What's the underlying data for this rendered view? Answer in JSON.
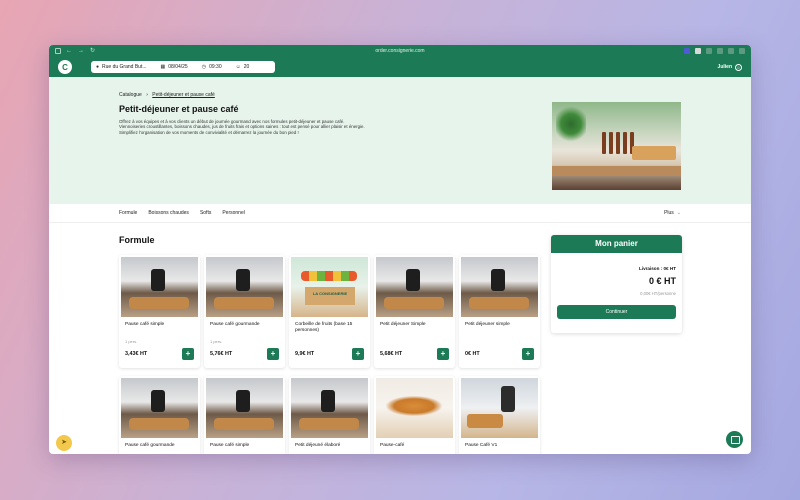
{
  "browser": {
    "url": "order.consignerie.com"
  },
  "header": {
    "address": "Rue du Grand But...",
    "date": "08/04/25",
    "time": "09:30",
    "guests": "20",
    "user": "Julien"
  },
  "hero": {
    "breadcrumb_root": "Catalogue",
    "breadcrumb_current": "Petit-déjeuner et pause café",
    "title": "Petit-déjeuner et pause café",
    "description_1": "Offrez à vos équipes et à vos clients un début de journée gourmand avec nos formules petit-déjeuner et pause café.",
    "description_2": "Viennoiseries croustillantes, boissons chaudes, jus de fruits frais et options saines : tout est pensé pour allier plaisir et énergie.",
    "description_3": "Simplifiez l'organisation de vos moments de convivialité et démarrez la journée du bon pied !"
  },
  "tabs": {
    "items": [
      "Formule",
      "Boissons chaudes",
      "Softs",
      "Personnel"
    ],
    "more": "Plus"
  },
  "section": {
    "title": "Formule"
  },
  "products": [
    {
      "name": "Pause café simple",
      "sub": "1 pers.",
      "price": "3,43€ HT"
    },
    {
      "name": "Pause café gourmande",
      "sub": "1 pers.",
      "price": "5,76€ HT"
    },
    {
      "name": "Corbeille de fruits (base 15 personnes)",
      "sub": "",
      "price": "9,9€ HT"
    },
    {
      "name": "Petit déjeuner Simple",
      "sub": "",
      "price": "5,68€ HT"
    },
    {
      "name": "Petit déjeuner simple",
      "sub": "",
      "price": "0€ HT"
    },
    {
      "name": "Pause café gourmande",
      "sub": "",
      "price": ""
    },
    {
      "name": "Pause café simple",
      "sub": "",
      "price": ""
    },
    {
      "name": "Petit déjeuné élaboré",
      "sub": "",
      "price": ""
    },
    {
      "name": "Pause-café",
      "sub": "",
      "price": ""
    },
    {
      "name": "Pause Café V1",
      "sub": "",
      "price": ""
    }
  ],
  "cart": {
    "title": "Mon panier",
    "delivery": "Livraison : 0€ HT",
    "total": "0 € HT",
    "per_person": "0,00€ HT/personne",
    "button": "Continuer"
  },
  "colors": {
    "brand": "#1d7a57",
    "hero_bg": "#e7f4ec"
  }
}
